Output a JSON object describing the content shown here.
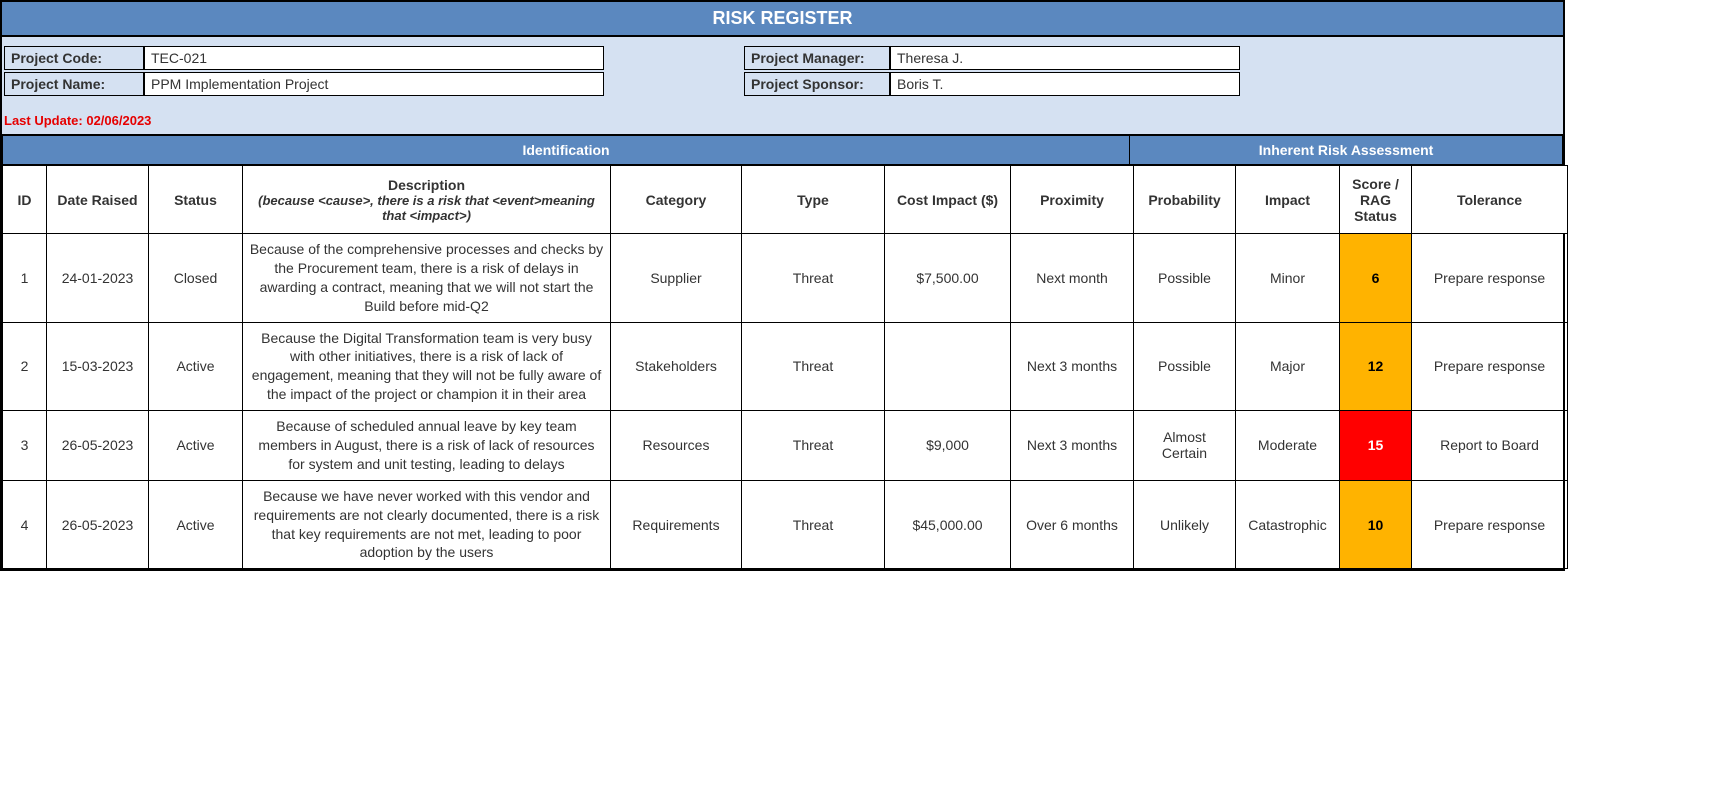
{
  "title": "RISK REGISTER",
  "header": {
    "project_code_label": "Project Code:",
    "project_code": "TEC-021",
    "project_name_label": "Project Name:",
    "project_name": "PPM Implementation Project",
    "project_manager_label": "Project Manager:",
    "project_manager": "Theresa J.",
    "project_sponsor_label": "Project Sponsor:",
    "project_sponsor": "Boris T."
  },
  "last_update_label": "Last Update: 02/06/2023",
  "sections": {
    "identification": "Identification",
    "assessment": "Inherent Risk Assessment"
  },
  "columns": {
    "id": "ID",
    "date_raised": "Date Raised",
    "status": "Status",
    "description": "Description",
    "description_sub": "(because <cause>, there is a risk that <event>meaning that <impact>)",
    "category": "Category",
    "type": "Type",
    "cost_impact": "Cost Impact ($)",
    "proximity": "Proximity",
    "probability": "Probability",
    "impact": "Impact",
    "score": "Score / RAG Status",
    "tolerance": "Tolerance"
  },
  "rows": [
    {
      "id": "1",
      "date_raised": "24-01-2023",
      "status": "Closed",
      "description": "Because of the comprehensive processes and checks by the Procurement team, there is a risk of delays in awarding a contract, meaning that we will not start the Build before mid-Q2",
      "category": "Supplier",
      "type": "Threat",
      "cost_impact": "$7,500.00",
      "proximity": "Next month",
      "probability": "Possible",
      "impact": "Minor",
      "score": "6",
      "rag": "amber",
      "tolerance": "Prepare response"
    },
    {
      "id": "2",
      "date_raised": "15-03-2023",
      "status": "Active",
      "description": "Because the Digital Transformation team is very busy with other initiatives, there is a risk of lack of engagement, meaning that they will not be fully aware of the impact of the project or champion it in their area",
      "category": "Stakeholders",
      "type": "Threat",
      "cost_impact": "",
      "proximity": "Next 3 months",
      "probability": "Possible",
      "impact": "Major",
      "score": "12",
      "rag": "amber",
      "tolerance": "Prepare response"
    },
    {
      "id": "3",
      "date_raised": "26-05-2023",
      "status": "Active",
      "description": "Because of scheduled annual leave by key team members in August, there is a risk of lack of resources for system and unit testing, leading to delays",
      "category": "Resources",
      "type": "Threat",
      "cost_impact": "$9,000",
      "proximity": "Next 3 months",
      "probability": "Almost Certain",
      "impact": "Moderate",
      "score": "15",
      "rag": "red",
      "tolerance": "Report to Board"
    },
    {
      "id": "4",
      "date_raised": "26-05-2023",
      "status": "Active",
      "description": "Because we have never worked with this vendor and requirements are not clearly documented, there is a risk that key requirements are not met, leading to poor adoption by the users",
      "category": "Requirements",
      "type": "Threat",
      "cost_impact": "$45,000.00",
      "proximity": "Over 6 months",
      "probability": "Unlikely",
      "impact": "Catastrophic",
      "score": "10",
      "rag": "amber",
      "tolerance": "Prepare response"
    }
  ]
}
